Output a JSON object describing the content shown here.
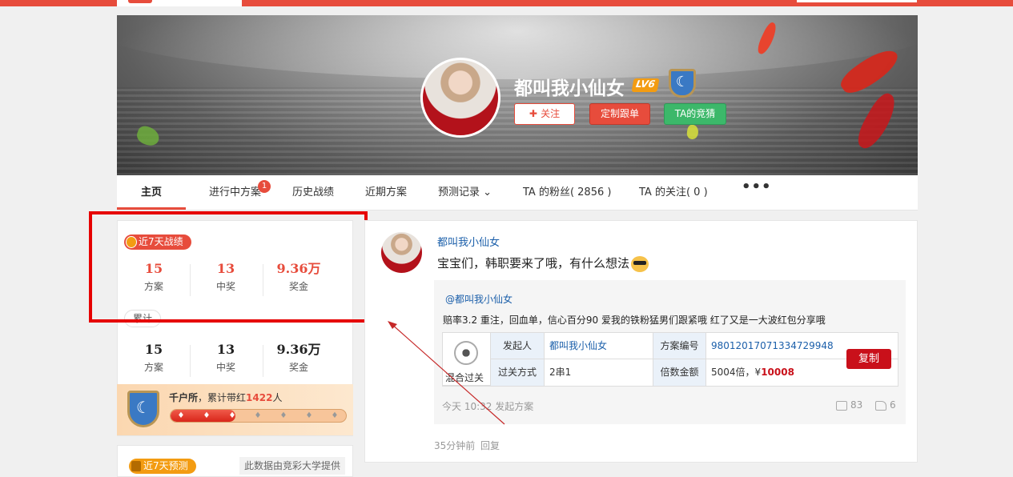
{
  "profile": {
    "name": "都叫我小仙女",
    "level": "LV6",
    "actions": {
      "follow": "关注",
      "custom": "定制跟单",
      "guess": "TA的竞猜"
    }
  },
  "nav": {
    "items": [
      {
        "label": "主页",
        "active": true
      },
      {
        "label": "进行中方案",
        "badge": "1"
      },
      {
        "label": "历史战绩"
      },
      {
        "label": "近期方案"
      },
      {
        "label": "预测记录"
      },
      {
        "label": "TA 的粉丝( 2856 )"
      },
      {
        "label": "TA 的关注( 0 )"
      }
    ],
    "more": "•••"
  },
  "stats7": {
    "tag": "近7天战绩",
    "items": [
      {
        "value": "15",
        "label": "方案"
      },
      {
        "value": "13",
        "label": "中奖"
      },
      {
        "value": "9.36万",
        "label": "奖金"
      }
    ]
  },
  "statsTotal": {
    "tag": "累计",
    "items": [
      {
        "value": "15",
        "label": "方案"
      },
      {
        "value": "13",
        "label": "中奖"
      },
      {
        "value": "9.36万",
        "label": "奖金"
      }
    ]
  },
  "honor": {
    "title": "千户所",
    "text": "，累计带红",
    "count": "1422",
    "unit": "人",
    "progress": 0.37
  },
  "prediction": {
    "tag": "近7天预测",
    "source": "此数据由竞彩大学提供"
  },
  "post": {
    "author": "都叫我小仙女",
    "text": "宝宝们，韩职要来了哦，有什么想法",
    "quote": {
      "author": "@都叫我小仙女",
      "text": "赔率3.2 重注，回血单，信心百分90 爱我的铁粉猛男们跟紧哦 红了又是一大波红包分享哦",
      "type": "混合过关",
      "launcher_label": "发起人",
      "launcher": "都叫我小仙女",
      "plan_no_label": "方案编号",
      "plan_no": "9801201707133472994​8",
      "mode_label": "过关方式",
      "mode": "2串1",
      "amount_label": "倍数金额",
      "amount_prefix": "5004倍，¥",
      "amount": "10008",
      "copy": "复制",
      "time": "今天 10:32  发起方案",
      "comments": "83",
      "likes": "6"
    },
    "time": "35分钟前",
    "reply": "回复"
  },
  "colors": {
    "accent": "#e74c3c",
    "link": "#1b5faa",
    "green": "#3cb86a",
    "highlight_box": "#e60000"
  }
}
